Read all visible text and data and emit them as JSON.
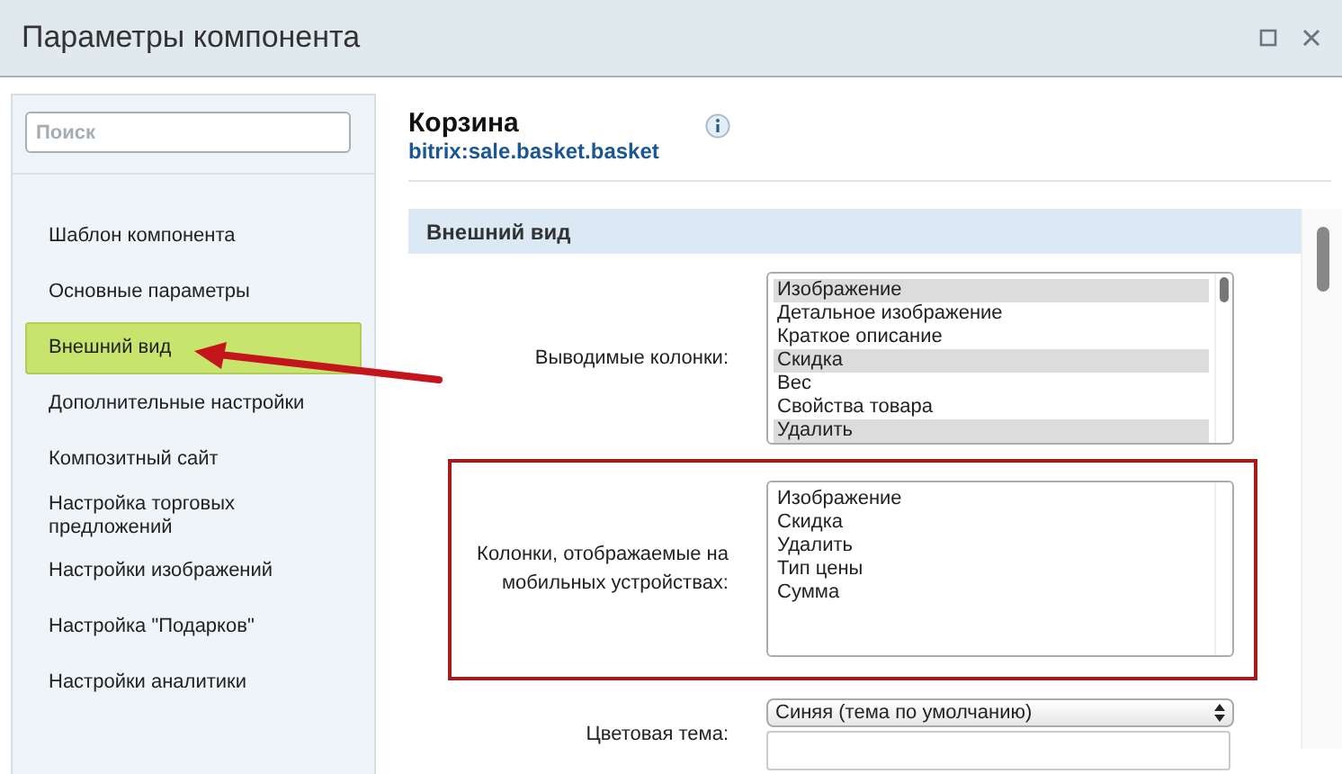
{
  "window": {
    "title": "Параметры компонента"
  },
  "sidebar": {
    "search": {
      "placeholder": "Поиск"
    },
    "items": [
      {
        "label": "Шаблон компонента",
        "selected": false
      },
      {
        "label": "Основные параметры",
        "selected": false
      },
      {
        "label": "Внешний вид",
        "selected": true
      },
      {
        "label": "Дополнительные настройки",
        "selected": false
      },
      {
        "label": "Композитный сайт",
        "selected": false
      },
      {
        "label": "Настройка торговых предложений",
        "selected": false
      },
      {
        "label": "Настройки изображений",
        "selected": false
      },
      {
        "label": "Настройка \"Подарков\"",
        "selected": false
      },
      {
        "label": "Настройки аналитики",
        "selected": false
      }
    ]
  },
  "component": {
    "name": "Корзина",
    "code": "bitrix:sale.basket.basket"
  },
  "section": {
    "title": "Внешний вид"
  },
  "fields": [
    {
      "kind": "listbox",
      "label": "Выводимые колонки:",
      "highlighted": false,
      "options": [
        {
          "label": "Изображение",
          "selected": true
        },
        {
          "label": "Детальное изображение",
          "selected": false
        },
        {
          "label": "Краткое описание",
          "selected": false
        },
        {
          "label": "Скидка",
          "selected": true
        },
        {
          "label": "Вес",
          "selected": false
        },
        {
          "label": "Свойства товара",
          "selected": false
        },
        {
          "label": "Удалить",
          "selected": true
        }
      ]
    },
    {
      "kind": "listbox",
      "label": "Колонки, отображаемые на мобильных устройствах:",
      "highlighted": true,
      "options": [
        {
          "label": "Изображение",
          "selected": false
        },
        {
          "label": "Скидка",
          "selected": false
        },
        {
          "label": "Удалить",
          "selected": false
        },
        {
          "label": "Тип цены",
          "selected": false
        },
        {
          "label": "Сумма",
          "selected": false
        }
      ]
    },
    {
      "kind": "select",
      "label": "Цветовая тема:",
      "highlighted": false,
      "value": "Синяя (тема по умолчанию)"
    }
  ]
}
